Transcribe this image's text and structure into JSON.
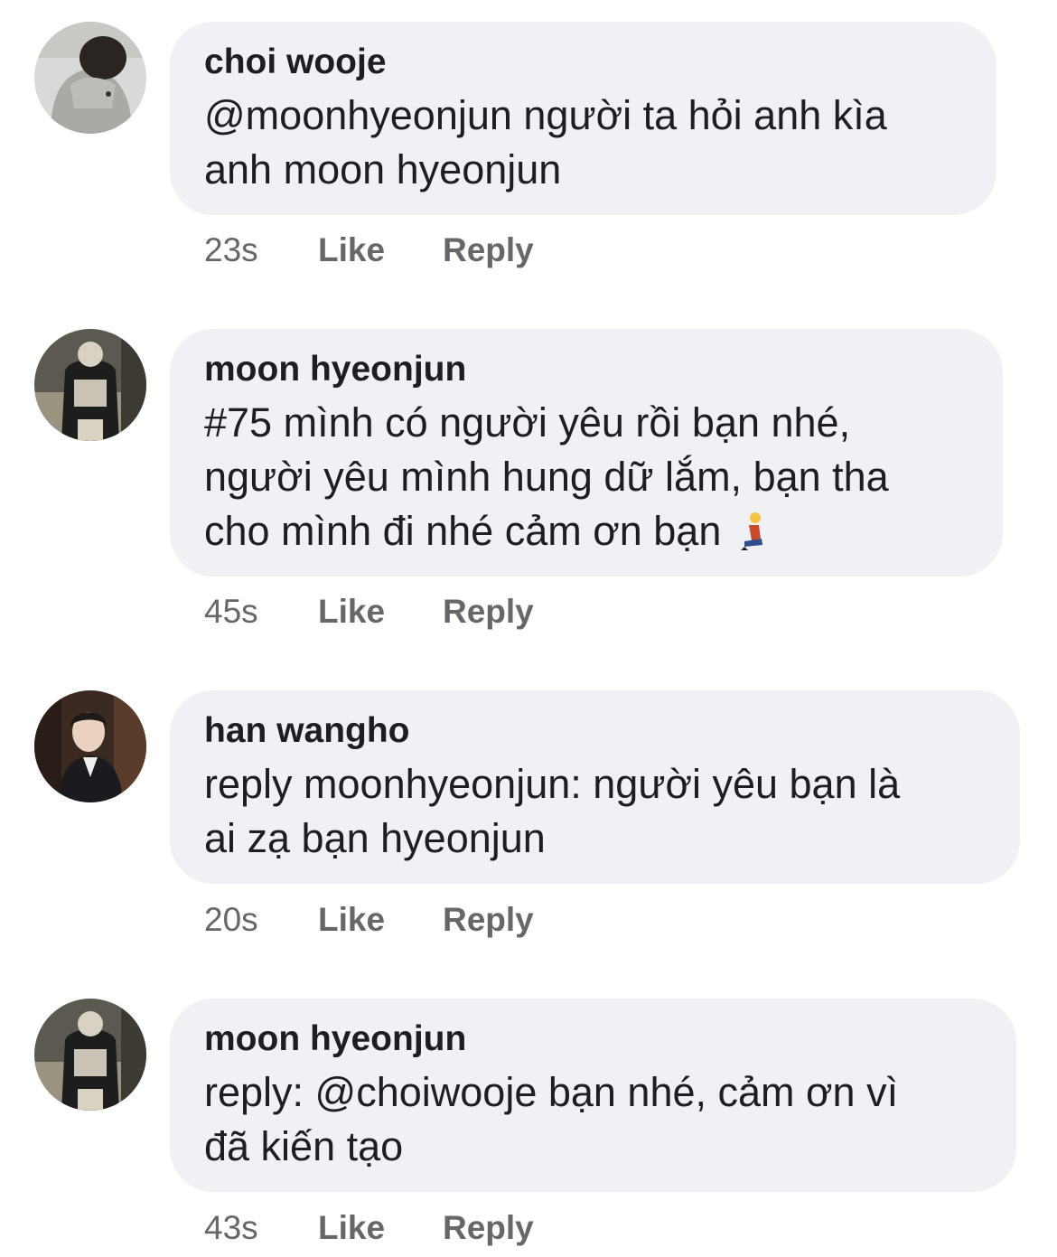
{
  "comments": [
    {
      "author": "choi wooje",
      "avatar_icon": "avatar-gray-hoodie",
      "lines": [
        "@moonhyeonjun người ta hỏi anh kìa",
        "anh moon hyeonjun"
      ],
      "time": "23s",
      "like_label": "Like",
      "reply_label": "Reply"
    },
    {
      "author": "moon hyeonjun",
      "avatar_icon": "avatar-champions-jacket",
      "lines": [
        "#75 mình có người yêu rồi bạn nhé,",
        "người yêu mình hung dữ lắm, bạn tha",
        "cho mình đi nhé cảm ơn bạn"
      ],
      "emoji": "kneeling-person-emoji",
      "time": "45s",
      "like_label": "Like",
      "reply_label": "Reply"
    },
    {
      "author": "han wangho",
      "avatar_icon": "avatar-suit",
      "lines": [
        "reply moonhyeonjun: người yêu bạn là",
        "ai zạ bạn hyeonjun"
      ],
      "time": "20s",
      "like_label": "Like",
      "reply_label": "Reply"
    },
    {
      "author": "moon hyeonjun",
      "avatar_icon": "avatar-champions-jacket",
      "lines": [
        "reply: @choiwooje bạn nhé, cảm ơn vì",
        "đã kiến tạo"
      ],
      "time": "43s",
      "like_label": "Like",
      "reply_label": "Reply"
    }
  ],
  "colors": {
    "bubble": "#f0f1f4",
    "text": "#1c1e21",
    "meta": "#65676b"
  }
}
